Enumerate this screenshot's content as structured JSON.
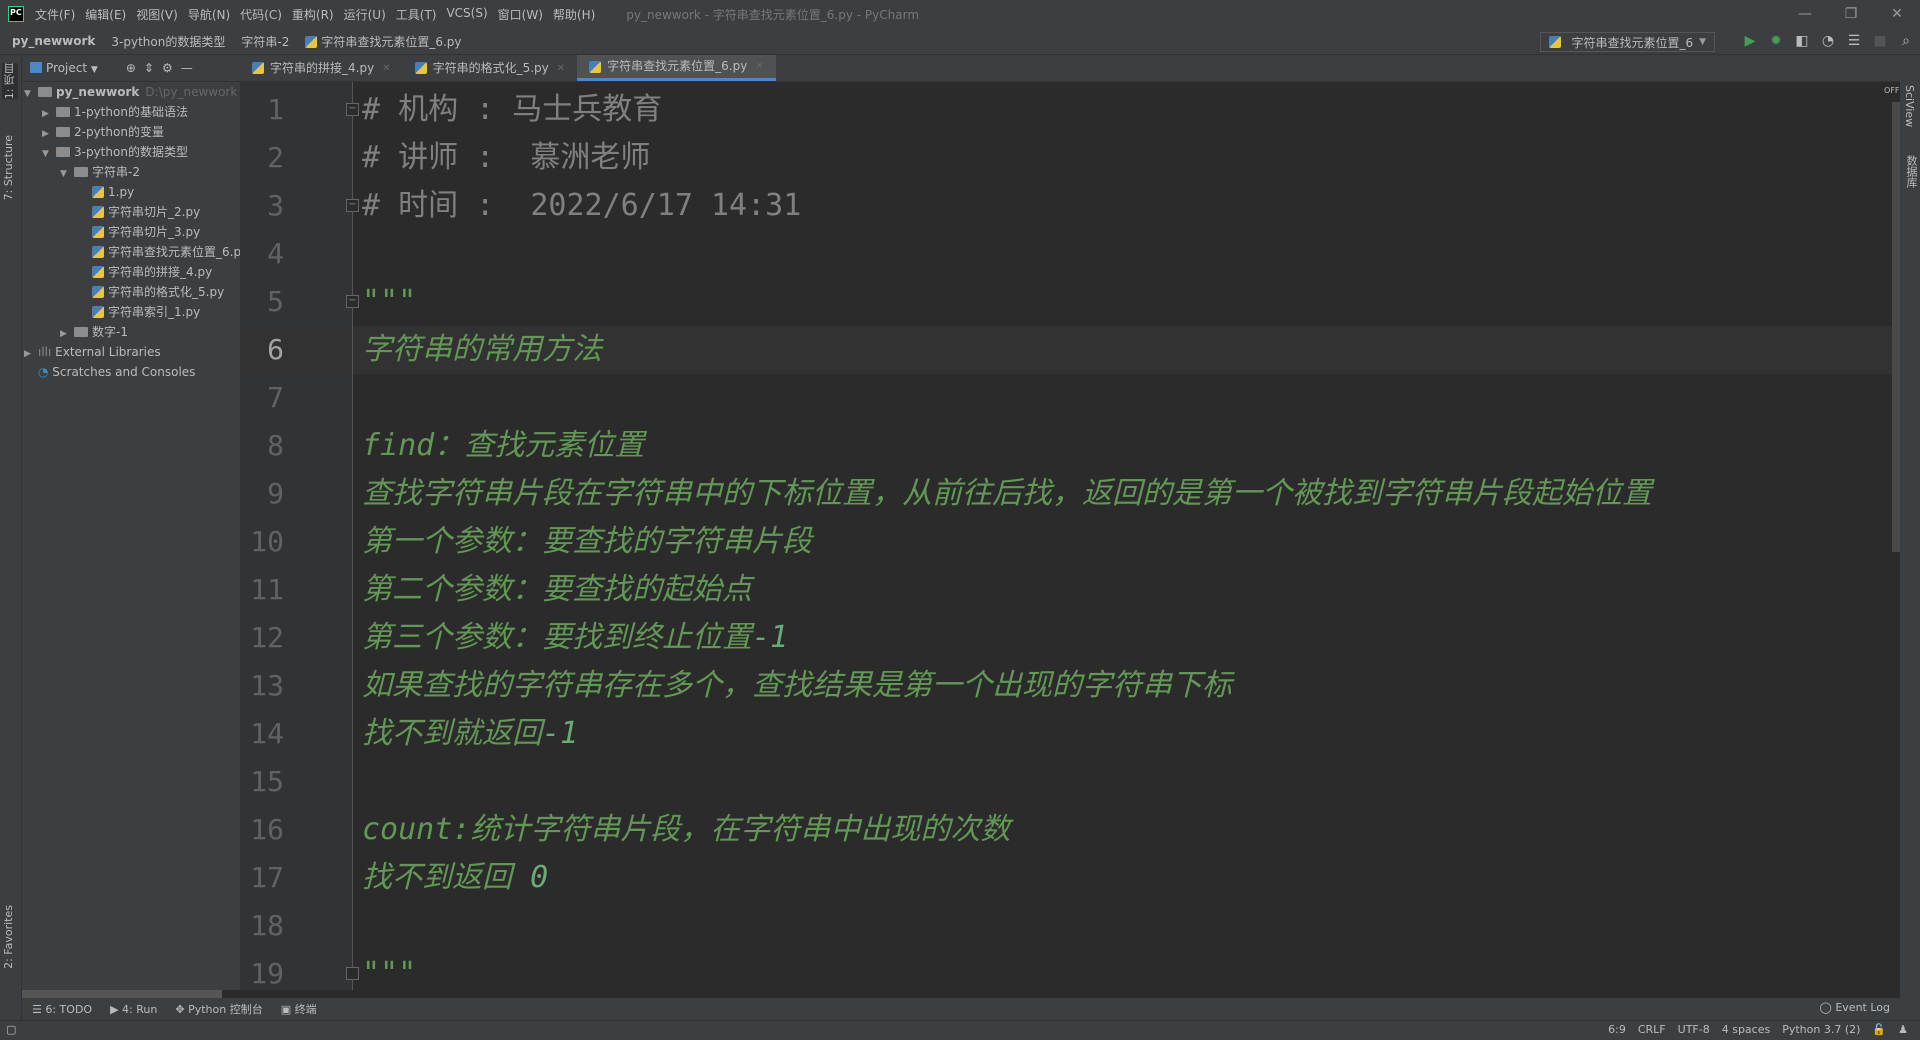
{
  "titlebar": {
    "logo": "PC",
    "menu": [
      "文件(F)",
      "编辑(E)",
      "视图(V)",
      "导航(N)",
      "代码(C)",
      "重构(R)",
      "运行(U)",
      "工具(T)",
      "VCS(S)",
      "窗口(W)",
      "帮助(H)"
    ],
    "title": "py_newwork - 字符串查找元素位置_6.py - PyCharm"
  },
  "navbar": {
    "crumbs": [
      "py_newwork",
      "3-python的数据类型",
      "字符串-2",
      "字符串查找元素位置_6.py"
    ],
    "run_config": "字符串查找元素位置_6"
  },
  "toolwindow": {
    "project_label": "Project",
    "left_tabs": [
      "1: 项目",
      "7: Structure",
      "2: Favorites"
    ],
    "right_tabs": [
      "SciView",
      "数据库"
    ]
  },
  "tree": [
    {
      "label": "py_newwork",
      "hint": "D:\\py_newwork",
      "depth": 0,
      "type": "folder",
      "open": true,
      "bold": true
    },
    {
      "label": "1-python的基础语法",
      "depth": 1,
      "type": "folder",
      "open": false
    },
    {
      "label": "2-python的变量",
      "depth": 1,
      "type": "folder",
      "open": false
    },
    {
      "label": "3-python的数据类型",
      "depth": 1,
      "type": "folder",
      "open": true
    },
    {
      "label": "字符串-2",
      "depth": 2,
      "type": "folder",
      "open": true
    },
    {
      "label": "1.py",
      "depth": 3,
      "type": "py"
    },
    {
      "label": "字符串切片_2.py",
      "depth": 3,
      "type": "py"
    },
    {
      "label": "字符串切片_3.py",
      "depth": 3,
      "type": "py"
    },
    {
      "label": "字符串查找元素位置_6.py",
      "depth": 3,
      "type": "py"
    },
    {
      "label": "字符串的拼接_4.py",
      "depth": 3,
      "type": "py"
    },
    {
      "label": "字符串的格式化_5.py",
      "depth": 3,
      "type": "py"
    },
    {
      "label": "字符串索引_1.py",
      "depth": 3,
      "type": "py"
    },
    {
      "label": "数字-1",
      "depth": 2,
      "type": "folder",
      "open": false
    },
    {
      "label": "External Libraries",
      "depth": 0,
      "type": "lib",
      "open": false
    },
    {
      "label": "Scratches and Consoles",
      "depth": 0,
      "type": "scratch"
    }
  ],
  "tabs": [
    {
      "label": "字符串的拼接_4.py",
      "active": false
    },
    {
      "label": "字符串的格式化_5.py",
      "active": false
    },
    {
      "label": "字符串查找元素位置_6.py",
      "active": true
    }
  ],
  "editor": {
    "current_line": 6,
    "scroll_off_label": "OFF",
    "lines": [
      [
        {
          "t": "# 机构 : 马士兵教育",
          "s": "comment"
        }
      ],
      [
        {
          "t": "# 讲师 :  慕洲老师",
          "s": "comment"
        }
      ],
      [
        {
          "t": "# 时间 :  2022/6/17 14:31",
          "s": "comment"
        }
      ],
      [],
      [
        {
          "t": "\"\"\"",
          "s": "doc"
        }
      ],
      [
        {
          "t": "字符串的常用方法",
          "s": "doc"
        }
      ],
      [],
      [
        {
          "t": "find：查找元素位置",
          "s": "doc"
        }
      ],
      [
        {
          "t": "查找字符串片段在字符串中的下标位置，从前往后找，返回的是第一个被找到字符串片段起始位置",
          "s": "doc"
        }
      ],
      [
        {
          "t": "第一个参数：要查找的字符串片段",
          "s": "doc"
        }
      ],
      [
        {
          "t": "第二个参数：要查找的起始点",
          "s": "doc"
        }
      ],
      [
        {
          "t": "第三个参数：要找到终止位置",
          "s": "doc"
        },
        {
          "t": "-1",
          "s": "docnum"
        }
      ],
      [
        {
          "t": "如果查找的字符串存在多个，查找结果是第一个出现的字符串下标",
          "s": "doc"
        }
      ],
      [
        {
          "t": "找不到就返回",
          "s": "doc"
        },
        {
          "t": "-1",
          "s": "docnum"
        }
      ],
      [],
      [
        {
          "t": "count:统计字符串片段，在字符串中出现的次数",
          "s": "doc"
        }
      ],
      [
        {
          "t": "找不到返回 ",
          "s": "doc"
        },
        {
          "t": "0",
          "s": "docnum"
        }
      ],
      [],
      [
        {
          "t": "\"\"\"",
          "s": "doc"
        }
      ]
    ]
  },
  "bottom_tools": [
    "6: TODO",
    "4: Run",
    "Python 控制台",
    "终端"
  ],
  "event_log": "Event Log",
  "status": {
    "position": "6:9",
    "line_sep": "CRLF",
    "encoding": "UTF-8",
    "indent": "4 spaces",
    "interpreter": "Python 3.7 (2)"
  },
  "colors": {
    "comment": "#808080",
    "docstring": "#629755",
    "editor_bg": "#2b2b2b",
    "panel_bg": "#3c3f41",
    "accent": "#4a88c7"
  }
}
